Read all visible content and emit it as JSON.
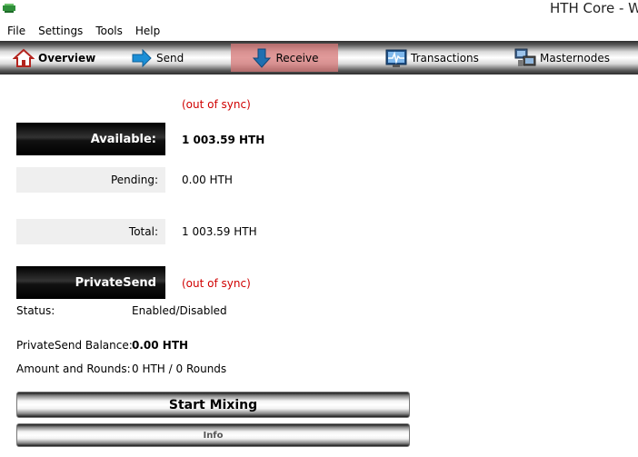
{
  "window": {
    "title": "HTH Core - W"
  },
  "menu": [
    "File",
    "Settings",
    "Tools",
    "Help"
  ],
  "toolbar": {
    "tabs": [
      {
        "label": "Overview",
        "icon": "home-icon",
        "active": false,
        "bold": true
      },
      {
        "label": "Send",
        "icon": "send-arrow-icon",
        "active": false,
        "bold": false
      },
      {
        "label": "Receive",
        "icon": "receive-arrow-icon",
        "active": true,
        "bold": false
      },
      {
        "label": "Transactions",
        "icon": "transactions-icon",
        "active": false,
        "bold": false
      },
      {
        "label": "Masternodes",
        "icon": "masternodes-icon",
        "active": false,
        "bold": false
      }
    ]
  },
  "balances": {
    "out_of_sync": "(out of sync)",
    "available_label": "Available:",
    "available_value": "1 003.59 HTH",
    "pending_label": "Pending:",
    "pending_value": "0.00 HTH",
    "total_label": "Total:",
    "total_value": "1 003.59 HTH"
  },
  "privatesend": {
    "header": "PrivateSend",
    "out_of_sync": "(out of sync)",
    "status_label": "Status:",
    "status_value": "Enabled/Disabled",
    "balance_label": "PrivateSend Balance:",
    "balance_value": "0.00 HTH",
    "rounds_label": "Amount and Rounds:",
    "rounds_value": "0 HTH / 0 Rounds",
    "start_button": "Start Mixing",
    "info_button": "Info"
  },
  "colors": {
    "warning": "#d00000",
    "active_tab": "#d77878"
  }
}
